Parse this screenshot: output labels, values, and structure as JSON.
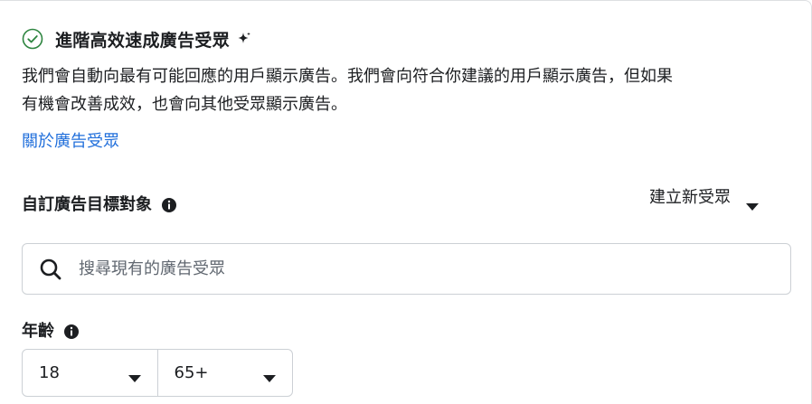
{
  "header": {
    "title": "進階高效速成廣告受眾",
    "check_icon": "check-circle-icon",
    "sparkle_icon": "sparkle-icon"
  },
  "description": {
    "line1": "我們會自動向最有可能回應的用戶顯示廣告。我們會向符合你建議的用戶顯示廣告，但如果",
    "line2": "有機會改善成效，也會向其他受眾顯示廣告。"
  },
  "about_link": "關於廣告受眾",
  "custom_audience": {
    "label": "自訂廣告目標對象",
    "info_icon": "info-icon",
    "create_new_label": "建立新受眾",
    "search_placeholder": "搜尋現有的廣告受眾",
    "search_value": ""
  },
  "age": {
    "label": "年齡",
    "info_icon": "info-icon",
    "min": "18",
    "max": "65+"
  },
  "colors": {
    "link": "#216fdb",
    "success": "#2e8540",
    "text": "#1c1e21",
    "border": "#ccd0d5"
  }
}
